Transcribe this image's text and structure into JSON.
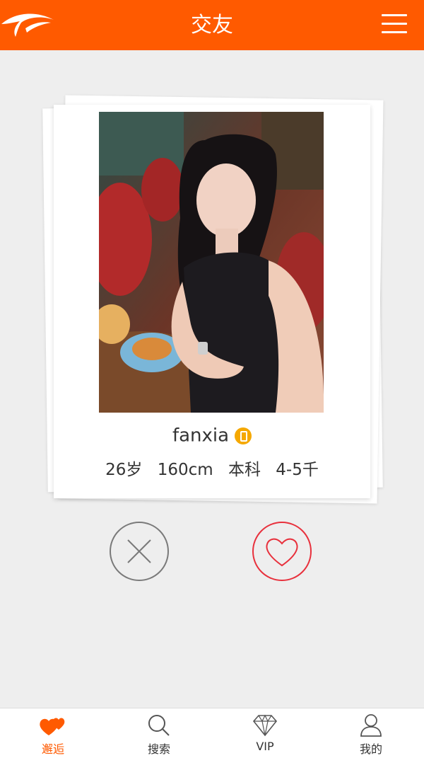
{
  "header": {
    "title": "交友",
    "logo_icon": "bird-logo-icon",
    "menu_icon": "hamburger-menu-icon"
  },
  "profile": {
    "name": "fanxia",
    "verified_icon": "phone-verified-badge-icon",
    "age": "26岁",
    "height": "160cm",
    "education": "本科",
    "income": "4-5千"
  },
  "actions": {
    "pass_icon": "close-x-icon",
    "like_icon": "heart-icon"
  },
  "tabs": [
    {
      "label": "邂逅",
      "icon": "hearts-icon",
      "active": true
    },
    {
      "label": "搜索",
      "icon": "search-icon",
      "active": false
    },
    {
      "label": "VIP",
      "icon": "diamond-icon",
      "active": false
    },
    {
      "label": "我的",
      "icon": "user-icon",
      "active": false
    }
  ],
  "colors": {
    "accent": "#ff5a00",
    "like": "#e8303c",
    "pass": "#7a7a7a",
    "background": "#eeeeee"
  }
}
